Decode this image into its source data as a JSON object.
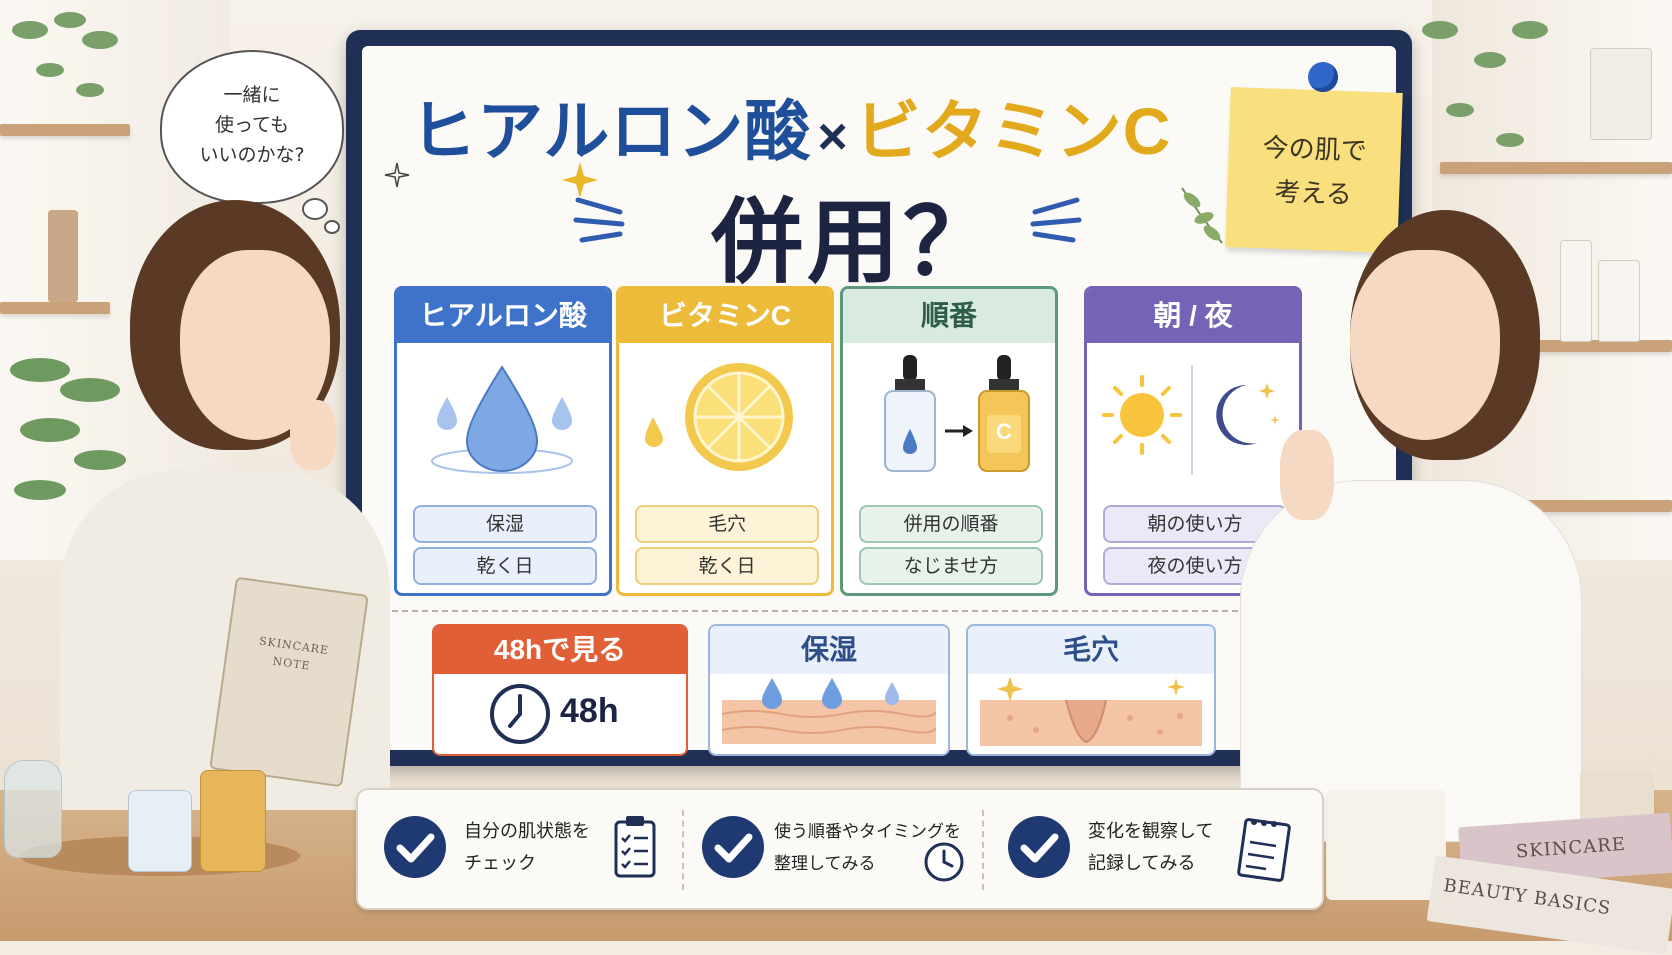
{
  "title": {
    "part1": "ヒアルロン酸",
    "times": "×",
    "part2": "ビタミンC",
    "main": "併用？"
  },
  "thought_bubble": {
    "lines": [
      "一緒に",
      "使っても",
      "いいのかな?"
    ]
  },
  "sticky_note": {
    "lines": [
      "今の肌で",
      "考える"
    ]
  },
  "cards": [
    {
      "title": "ヒアルロン酸",
      "items": [
        "保湿",
        "乾く日"
      ],
      "color": "#3f73c9",
      "light": "#e9f0fb",
      "icon": "water-drop-icon"
    },
    {
      "title": "ビタミンC",
      "items": [
        "毛穴",
        "乾く日"
      ],
      "color": "#edbb3a",
      "light": "#fdf3d6",
      "icon": "lemon-icon"
    },
    {
      "title": "順番",
      "items": [
        "併用の順番",
        "なじませ方"
      ],
      "color": "#5a9a7a",
      "light": "#e7f2ea",
      "icon": "serum-bottles-icon",
      "bottle_label": "C"
    },
    {
      "title": "朝 / 夜",
      "items": [
        "朝の使い方",
        "夜の使い方"
      ],
      "color": "#7463b6",
      "light": "#ece8f7",
      "icon": "sun-moon-icon"
    }
  ],
  "lower_panels": [
    {
      "title": "48hで見る",
      "value": "48h",
      "color": "#e05f36",
      "icon": "clock-icon"
    },
    {
      "title": "保湿",
      "color": "#3f73c9",
      "icon": "skin-moisture-icon"
    },
    {
      "title": "毛穴",
      "color": "#3f73c9",
      "icon": "skin-pore-icon"
    }
  ],
  "checklist": [
    {
      "lines": [
        "自分の肌状態を",
        "チェック"
      ],
      "icon": "clipboard-icon"
    },
    {
      "lines": [
        "使う順番やタイミングを",
        "整理してみる"
      ],
      "icon": "clock-icon"
    },
    {
      "lines": [
        "変化を観察して",
        "記録してみる"
      ],
      "icon": "notepad-icon"
    }
  ],
  "props": {
    "notebook": [
      "SKINCARE",
      "NOTE"
    ],
    "book_top": "SKINCARE",
    "book_bottom": "BEAUTY BASICS"
  },
  "colors": {
    "navy": "#1f2f55",
    "blue": "#1f4e9a",
    "gold": "#e3a91c",
    "check": "#1f3a72"
  }
}
